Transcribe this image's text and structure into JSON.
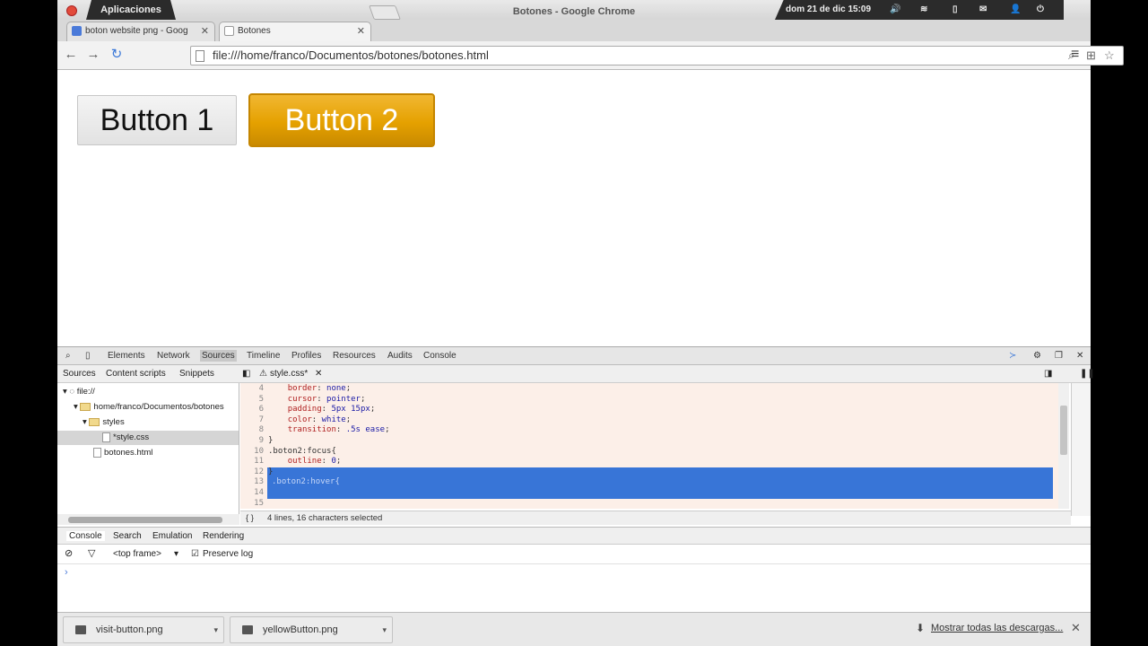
{
  "system_bar": {
    "apps_label": "Aplicaciones",
    "window_title": "Botones - Google Chrome",
    "datetime": "dom 21 de dic 15:09"
  },
  "tabs": [
    {
      "label": "boton website png - Goog",
      "favicon": "google-icon",
      "active": false
    },
    {
      "label": "Botones",
      "favicon": "page-icon",
      "active": true
    }
  ],
  "omnibox": {
    "url": "file:///home/franco/Documentos/botones/botones.html"
  },
  "page": {
    "button1_label": "Button 1",
    "button2_label": "Button 2"
  },
  "devtools": {
    "tabs": [
      "Elements",
      "Network",
      "Sources",
      "Timeline",
      "Profiles",
      "Resources",
      "Audits",
      "Console"
    ],
    "active_tab": "Sources",
    "sources_subtabs": [
      "Sources",
      "Content scripts",
      "Snippets"
    ],
    "open_file_tab": "style.css*",
    "tree": [
      {
        "label": "file://",
        "type": "root"
      },
      {
        "label": "home/franco/Documentos/botones",
        "type": "folder"
      },
      {
        "label": "styles",
        "type": "folder"
      },
      {
        "label": "*style.css",
        "type": "file",
        "selected": true
      },
      {
        "label": "botones.html",
        "type": "file"
      }
    ],
    "code_lines": [
      {
        "num": "4",
        "indent": "    ",
        "prop": "border",
        "val": "none"
      },
      {
        "num": "5",
        "indent": "    ",
        "prop": "cursor",
        "val": "pointer"
      },
      {
        "num": "6",
        "indent": "    ",
        "prop": "padding",
        "val": "5px 15px"
      },
      {
        "num": "7",
        "indent": "    ",
        "prop": "color",
        "val": "white"
      },
      {
        "num": "8",
        "indent": "    ",
        "prop": "transition",
        "val": ".5s ease"
      },
      {
        "num": "9",
        "text": "}"
      },
      {
        "num": "10",
        "text": ".boton2:focus{"
      },
      {
        "num": "11",
        "indent": "    ",
        "prop": "outline",
        "val": "0"
      },
      {
        "num": "12",
        "text": "}"
      },
      {
        "num": "13",
        "text": ""
      },
      {
        "num": "14",
        "text": ""
      },
      {
        "num": "15",
        "text": ""
      }
    ],
    "selected_text": ".boton2:hover{",
    "status": "4 lines, 16 characters selected",
    "drawer_tabs": [
      "Console",
      "Search",
      "Emulation",
      "Rendering"
    ],
    "frame_selector": "<top frame>",
    "preserve_log": "Preserve log",
    "prompt": "›"
  },
  "downloads": {
    "items": [
      "visit-button.png",
      "yellowButton.png"
    ],
    "show_all": "Mostrar todas las descargas..."
  },
  "colors": {
    "button2": "#e5a100",
    "selection": "#3875d7",
    "editor_bg": "#fcefe8"
  }
}
